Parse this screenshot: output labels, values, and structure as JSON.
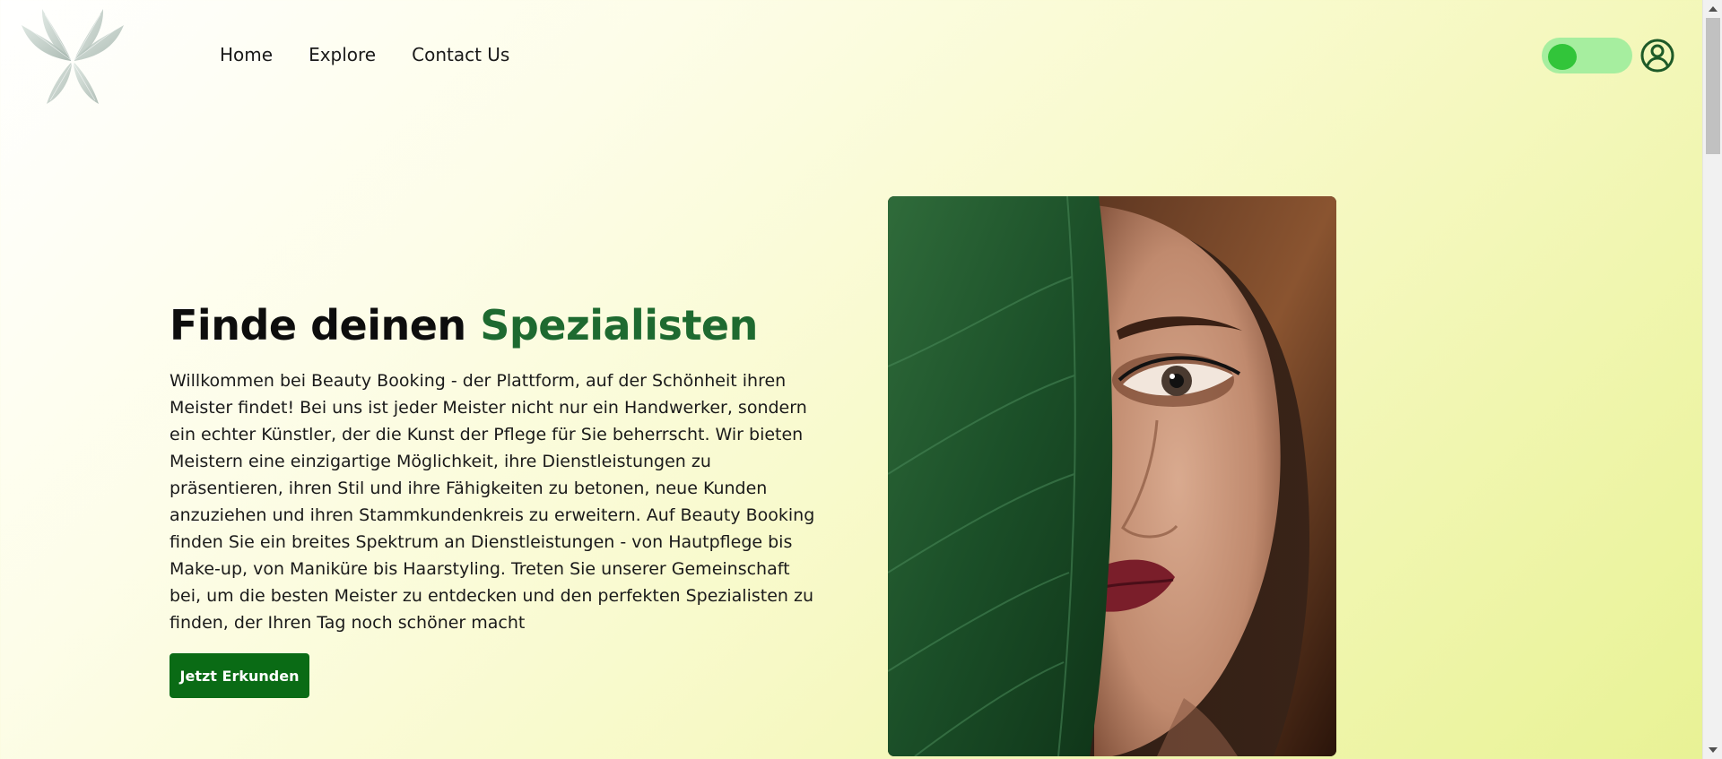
{
  "header": {
    "logo_icon": "butterfly-logo",
    "nav": {
      "home": "Home",
      "explore": "Explore",
      "contact": "Contact Us"
    },
    "toggle_icon": "theme-toggle",
    "user_icon": "user-account-icon"
  },
  "hero": {
    "title_part1": "Finde deinen ",
    "title_part2": "Spezialisten",
    "description": "Willkommen bei Beauty Booking - der Plattform, auf der Schönheit ihren Meister findet! Bei uns ist jeder Meister nicht nur ein Handwerker, sondern ein echter Künstler, der die Kunst der Pflege für Sie beherrscht. Wir bieten Meistern eine einzigartige Möglichkeit, ihre Dienstleistungen zu präsentieren, ihren Stil und ihre Fähigkeiten zu betonen, neue Kunden anzuziehen und ihren Stammkundenkreis zu erweitern. Auf Beauty Booking finden Sie ein breites Spektrum an Dienstleistungen - von Hautpflege bis Make-up, von Maniküre bis Haarstyling. Treten Sie unserer Gemeinschaft bei, um die besten Meister zu entdecken und den perfekten Spezialisten zu finden, der Ihren Tag noch schöner macht",
    "cta_label": "Jetzt Erkunden",
    "image_icon": "woman-with-leaf-photo"
  },
  "colors": {
    "accent": "#1e6a30",
    "button": "#0a6b15",
    "toggle_track": "#a6ee9f",
    "toggle_knob": "#32c53a"
  }
}
